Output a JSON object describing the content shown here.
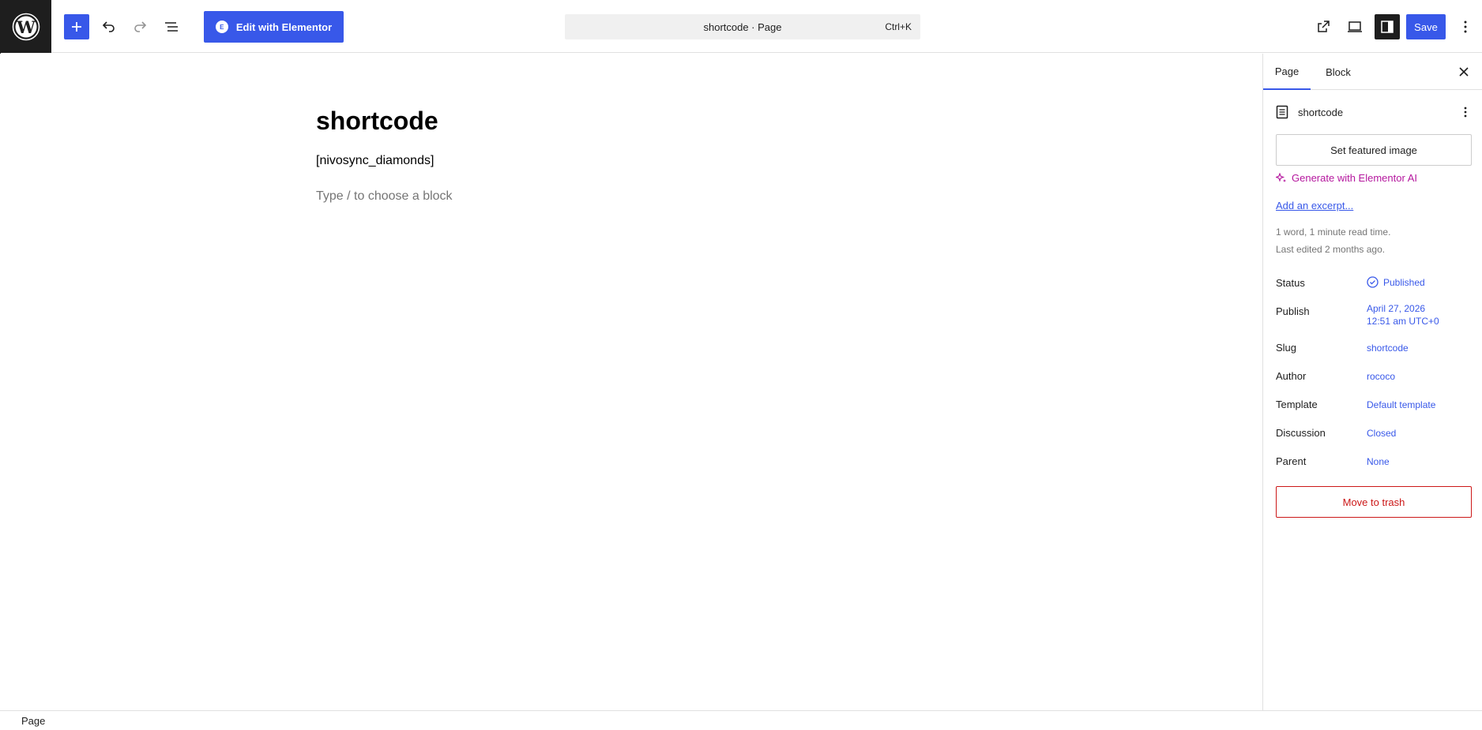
{
  "toolbar": {
    "add_block_icon": "plus-icon",
    "undo_icon": "undo-icon",
    "redo_icon": "redo-icon",
    "list_view_icon": "list-view-icon",
    "elementor_label": "Edit with Elementor",
    "command_title": "shortcode · Page",
    "command_shortcut": "Ctrl+K",
    "save_label": "Save"
  },
  "editor": {
    "title": "shortcode",
    "shortcode_text": "[nivosync_diamonds]",
    "block_placeholder": "Type / to choose a block"
  },
  "sidebar": {
    "tabs": [
      {
        "label": "Page"
      },
      {
        "label": "Block"
      }
    ],
    "doc_title": "shortcode",
    "featured_image_label": "Set featured image",
    "generate_ai_label": "Generate with Elementor AI",
    "excerpt_label": "Add an excerpt...",
    "meta_line1": "1 word, 1 minute read time.",
    "meta_line2": "Last edited 2 months ago.",
    "props": {
      "status": {
        "label": "Status",
        "value": "Published"
      },
      "publish": {
        "label": "Publish",
        "value1": "April 27, 2026",
        "value2": "12:51 am UTC+0"
      },
      "slug": {
        "label": "Slug",
        "value": "shortcode"
      },
      "author": {
        "label": "Author",
        "value": "rococo"
      },
      "template": {
        "label": "Template",
        "value": "Default template"
      },
      "discussion": {
        "label": "Discussion",
        "value": "Closed"
      },
      "parent": {
        "label": "Parent",
        "value": "None"
      }
    },
    "trash_label": "Move to trash"
  },
  "footer": {
    "breadcrumb": "Page"
  },
  "colors": {
    "accent": "#3858e9",
    "dark": "#1e1e1e",
    "ai_pink": "#b5179e",
    "danger": "#cc1818"
  }
}
